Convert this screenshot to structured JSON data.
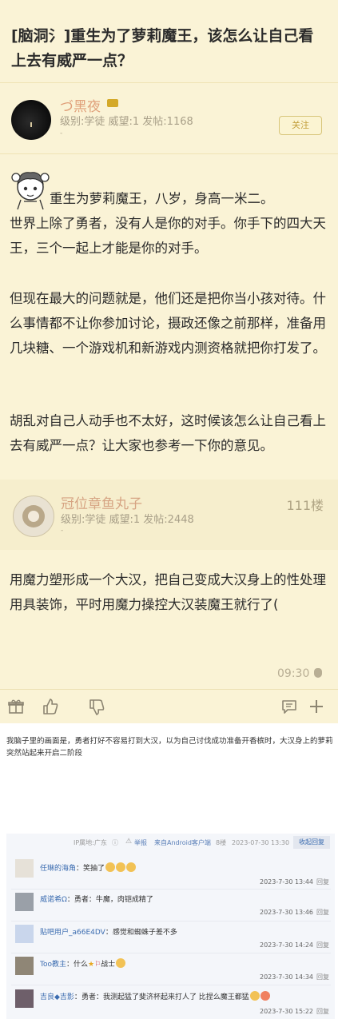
{
  "post": {
    "title": "[脑洞氵]重生为了萝莉魔王，该怎么让自己看上去有威严一点？",
    "op": {
      "name": "づ黑夜",
      "info": "级别:学徒 威望:1 发帖:1168",
      "follow_label": "关注"
    },
    "body": [
      "重生为萝莉魔王，八岁，身高一米二。\n世界上除了勇者，没有人是你的对手。你手下的四大天王，三个一起上才能是你的对手。",
      "但现在最大的问题就是，他们还是把你当小孩对待。什么事情都不让你参加讨论，摄政还像之前那样，准备用几块糖、一个游戏机和新游戏内测资格就把你打发了。",
      "胡乱对自己人动手也不太好，这时候该怎么让自己看上去有威严一点？让大家也参考一下你的意见。"
    ],
    "reply": {
      "name": "冠位章鱼丸子",
      "info": "级别:学徒 威望:1 发帖:2448",
      "floor": "111楼",
      "text": "用魔力塑形成一个大汉，把自己变成大汉身上的性处理用具装饰，平时用魔力操控大汉装魔王就行了(",
      "time": "09:30"
    },
    "actions": [
      "gift-icon",
      "like-icon",
      "dislike-icon",
      "comment-icon",
      "plus-icon"
    ]
  },
  "caption": "我脑子里的画面是，勇者打好不容易打到大汉，以为自己讨伐成功准备开香槟时，大汉身上的萝莉突然站起来开启二阶段",
  "comments_meta": {
    "ip": "IP属地:广东",
    "report": "举报",
    "client": "来自Android客户端",
    "floor": "8楼",
    "datetime": "2023-07-30 13:30",
    "collapse": "收起回复"
  },
  "comments": [
    {
      "name": "任琳的海角",
      "text": "笑抽了",
      "time": "2023-7-30 13:44",
      "reply": "回复"
    },
    {
      "name": "威诺希Ω",
      "text": "勇者：牛魔，肉铠成精了",
      "time": "2023-7-30 13:46",
      "reply": "回复"
    },
    {
      "name": "贴吧用户_a66E4DV",
      "text": "感觉和蜘蛛子差不多",
      "time": "2023-7-30 14:24",
      "reply": "回复"
    },
    {
      "name": "Too教主",
      "text": "什么",
      "text2": "战士",
      "time": "2023-7-30 14:34",
      "reply": "回复"
    },
    {
      "name": "吉良◆吉影",
      "text": "勇者：我测起猛了斐济杯起来打人了 比捏么魔王都猛",
      "time": "2023-7-30 15:22",
      "reply": "回复"
    }
  ]
}
